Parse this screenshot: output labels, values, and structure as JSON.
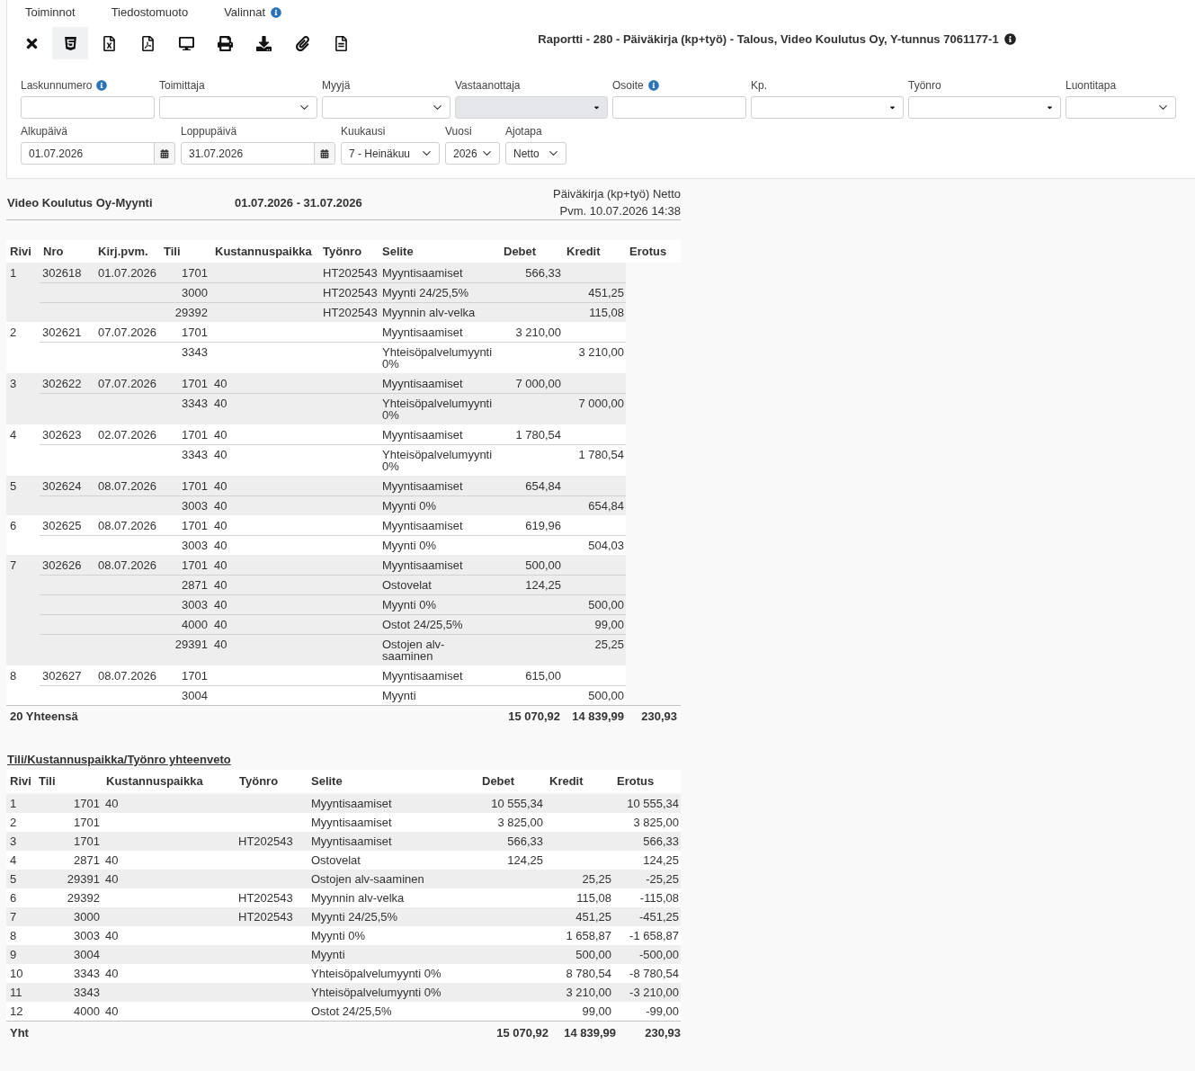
{
  "menu": [
    {
      "label": "Toiminnot",
      "info": false
    },
    {
      "label": "Tiedostomuoto",
      "info": false
    },
    {
      "label": "Valinnat",
      "info": true
    }
  ],
  "toolbar": [
    {
      "kind": "close",
      "selected": false
    },
    {
      "kind": "html",
      "selected": true
    },
    {
      "kind": "excel",
      "selected": false
    },
    {
      "kind": "pdf",
      "selected": false
    },
    {
      "kind": "screen",
      "selected": false
    },
    {
      "kind": "print",
      "selected": false
    },
    {
      "kind": "download",
      "selected": false
    },
    {
      "kind": "attach",
      "selected": false
    },
    {
      "kind": "document",
      "selected": false
    }
  ],
  "title": {
    "text": "Raportti - 280 - Päiväkirja (kp+työ) - Talous, Video Koulutus Oy, Y-tunnus 7061177-1",
    "info": true
  },
  "filters": [
    {
      "fields": [
        {
          "label": "Laskunnumero",
          "kind": "text",
          "info": true,
          "disabled": false
        },
        {
          "label": "Toimittaja",
          "kind": "select",
          "info": false,
          "disabled": false
        },
        {
          "label": "Myyjä",
          "kind": "select",
          "info": false,
          "disabled": false
        },
        {
          "label": "Vastaanottaja",
          "kind": "combo",
          "info": false,
          "disabled": true
        },
        {
          "label": "Osoite",
          "kind": "text",
          "info": true,
          "disabled": false
        },
        {
          "label": "Kp.",
          "kind": "combo",
          "info": false,
          "disabled": false
        },
        {
          "label": "Työnro",
          "kind": "combo",
          "info": false,
          "disabled": false
        },
        {
          "label": "Luontitapa",
          "kind": "select",
          "info": false,
          "disabled": false
        }
      ]
    },
    {
      "fields": [
        {
          "label": "Alkupäivä",
          "kind": "date",
          "info": false,
          "disabled": false,
          "value": "01.07.2026"
        },
        {
          "label": "Loppupäivä",
          "kind": "date",
          "info": false,
          "disabled": false,
          "value": "31.07.2026"
        },
        {
          "label": "Kuukausi",
          "kind": "select",
          "info": false,
          "disabled": false,
          "value": "7 - Heinäkuu"
        },
        {
          "label": "Vuosi",
          "kind": "select",
          "info": false,
          "disabled": false,
          "value": "2026"
        },
        {
          "label": "Ajotapa",
          "kind": "select",
          "info": false,
          "disabled": false,
          "value": "Netto"
        }
      ]
    }
  ],
  "report": {
    "name": "Video Koulutus Oy-Myynti",
    "period": "01.07.2026 - 31.07.2026",
    "type": "Päiväkirja (kp+työ) Netto",
    "printed": "Pvm. 10.07.2026 14:38"
  },
  "journal": {
    "columns": [
      "Rivi",
      "Nro",
      "Kirj.pvm.",
      "Tili",
      "Kustannuspaikka",
      "Työnro",
      "Selite",
      "Debet",
      "Kredit",
      "Erotus"
    ],
    "entries": [
      {
        "rivi": "1",
        "nro": "302618",
        "kirj_pvm": "01.07.2026",
        "lines": [
          {
            "tili": "1701",
            "tyonro": "HT202543",
            "selite": "Myyntisaamiset",
            "debet": "566,33"
          },
          {
            "tili": "3000",
            "tyonro": "HT202543",
            "selite": "Myynti 24/25,5%",
            "kredit": "451,25"
          },
          {
            "tili": "29392",
            "tyonro": "HT202543",
            "selite": "Myynnin alv-velka",
            "kredit": "115,08"
          }
        ]
      },
      {
        "rivi": "2",
        "nro": "302621",
        "kirj_pvm": "07.07.2026",
        "lines": [
          {
            "tili": "1701",
            "selite": "Myyntisaamiset",
            "debet": "3 210,00"
          },
          {
            "tili": "3343",
            "selite": "Yhteisöpalvelumyynti 0%",
            "kredit": "3 210,00"
          }
        ]
      },
      {
        "rivi": "3",
        "nro": "302622",
        "kirj_pvm": "07.07.2026",
        "lines": [
          {
            "tili": "1701",
            "kp": "40",
            "selite": "Myyntisaamiset",
            "debet": "7 000,00"
          },
          {
            "tili": "3343",
            "kp": "40",
            "selite": "Yhteisöpalvelumyynti 0%",
            "kredit": "7 000,00"
          }
        ]
      },
      {
        "rivi": "4",
        "nro": "302623",
        "kirj_pvm": "02.07.2026",
        "lines": [
          {
            "tili": "1701",
            "kp": "40",
            "selite": "Myyntisaamiset",
            "debet": "1 780,54"
          },
          {
            "tili": "3343",
            "kp": "40",
            "selite": "Yhteisöpalvelumyynti 0%",
            "kredit": "1 780,54"
          }
        ]
      },
      {
        "rivi": "5",
        "nro": "302624",
        "kirj_pvm": "08.07.2026",
        "lines": [
          {
            "tili": "1701",
            "kp": "40",
            "selite": "Myyntisaamiset",
            "debet": "654,84"
          },
          {
            "tili": "3003",
            "kp": "40",
            "selite": "Myynti 0%",
            "kredit": "654,84"
          }
        ]
      },
      {
        "rivi": "6",
        "nro": "302625",
        "kirj_pvm": "08.07.2026",
        "lines": [
          {
            "tili": "1701",
            "kp": "40",
            "selite": "Myyntisaamiset",
            "debet": "619,96"
          },
          {
            "tili": "3003",
            "kp": "40",
            "selite": "Myynti 0%",
            "kredit": "504,03"
          }
        ]
      },
      {
        "rivi": "7",
        "nro": "302626",
        "kirj_pvm": "08.07.2026",
        "lines": [
          {
            "tili": "1701",
            "kp": "40",
            "selite": "Myyntisaamiset",
            "debet": "500,00"
          },
          {
            "tili": "2871",
            "kp": "40",
            "selite": "Ostovelat",
            "debet": "124,25"
          },
          {
            "tili": "3003",
            "kp": "40",
            "selite": "Myynti 0%",
            "kredit": "500,00"
          },
          {
            "tili": "4000",
            "kp": "40",
            "selite": "Ostot 24/25,5%",
            "kredit": "99,00"
          },
          {
            "tili": "29391",
            "kp": "40",
            "selite": "Ostojen alv-saaminen",
            "kredit": "25,25"
          }
        ]
      },
      {
        "rivi": "8",
        "nro": "302627",
        "kirj_pvm": "08.07.2026",
        "lines": [
          {
            "tili": "1701",
            "selite": "Myyntisaamiset",
            "debet": "615,00"
          },
          {
            "tili": "3004",
            "selite": "Myynti",
            "kredit": "500,00"
          }
        ]
      }
    ],
    "total": {
      "label": "20 Yhteensä",
      "debet": "15 070,92",
      "kredit": "14 839,99",
      "erotus": "230,93"
    }
  },
  "summary": {
    "title": "Tili/Kustannuspaikka/Työnro yhteenveto",
    "columns": [
      "Rivi",
      "Tili",
      "Kustannuspaikka",
      "Työnro",
      "Selite",
      "Debet",
      "Kredit",
      "Erotus"
    ],
    "rows": [
      {
        "rivi": "1",
        "tili": "1701",
        "kp": "40",
        "selite": "Myyntisaamiset",
        "debet": "10 555,34",
        "erotus": "10 555,34"
      },
      {
        "rivi": "2",
        "tili": "1701",
        "selite": "Myyntisaamiset",
        "debet": "3 825,00",
        "erotus": "3 825,00"
      },
      {
        "rivi": "3",
        "tili": "1701",
        "tyonro": "HT202543",
        "selite": "Myyntisaamiset",
        "debet": "566,33",
        "erotus": "566,33"
      },
      {
        "rivi": "4",
        "tili": "2871",
        "kp": "40",
        "selite": "Ostovelat",
        "debet": "124,25",
        "erotus": "124,25"
      },
      {
        "rivi": "5",
        "tili": "29391",
        "kp": "40",
        "selite": "Ostojen alv-saaminen",
        "kredit": "25,25",
        "erotus": "-25,25"
      },
      {
        "rivi": "6",
        "tili": "29392",
        "tyonro": "HT202543",
        "selite": "Myynnin alv-velka",
        "kredit": "115,08",
        "erotus": "-115,08"
      },
      {
        "rivi": "7",
        "tili": "3000",
        "tyonro": "HT202543",
        "selite": "Myynti 24/25,5%",
        "kredit": "451,25",
        "erotus": "-451,25"
      },
      {
        "rivi": "8",
        "tili": "3003",
        "kp": "40",
        "selite": "Myynti 0%",
        "kredit": "1 658,87",
        "erotus": "-1 658,87"
      },
      {
        "rivi": "9",
        "tili": "3004",
        "selite": "Myynti",
        "kredit": "500,00",
        "erotus": "-500,00"
      },
      {
        "rivi": "10",
        "tili": "3343",
        "kp": "40",
        "selite": "Yhteisöpalvelumyynti 0%",
        "kredit": "8 780,54",
        "erotus": "-8 780,54"
      },
      {
        "rivi": "11",
        "tili": "3343",
        "selite": "Yhteisöpalvelumyynti 0%",
        "kredit": "3 210,00",
        "erotus": "-3 210,00"
      },
      {
        "rivi": "12",
        "tili": "4000",
        "kp": "40",
        "selite": "Ostot 24/25,5%",
        "kredit": "99,00",
        "erotus": "-99,00"
      }
    ],
    "total": {
      "label": "Yht",
      "debet": "15 070,92",
      "kredit": "14 839,99",
      "erotus": "230,93"
    }
  }
}
